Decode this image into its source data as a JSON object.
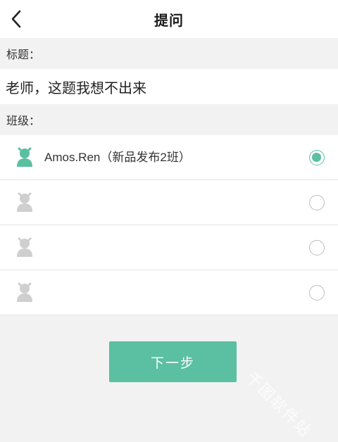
{
  "header": {
    "title": "提问",
    "back_icon": "chevron-left-icon"
  },
  "form": {
    "title_label": "标题：",
    "title_value": "老师，这题我想不出来",
    "class_label": "班级："
  },
  "classes": [
    {
      "name": "Amos.Ren（新品发布2班）",
      "selected": true,
      "icon": "person-icon",
      "icon_color": "#5bbfa1"
    },
    {
      "name": "",
      "selected": false,
      "icon": "person-icon",
      "icon_color": "#cfcfcf"
    },
    {
      "name": "",
      "selected": false,
      "icon": "person-icon",
      "icon_color": "#cfcfcf"
    },
    {
      "name": "",
      "selected": false,
      "icon": "person-icon",
      "icon_color": "#cfcfcf"
    }
  ],
  "next_button": {
    "label": "下一步"
  },
  "watermark": "千图软件站",
  "colors": {
    "accent": "#5bbfa1",
    "background": "#f2f2f2"
  }
}
